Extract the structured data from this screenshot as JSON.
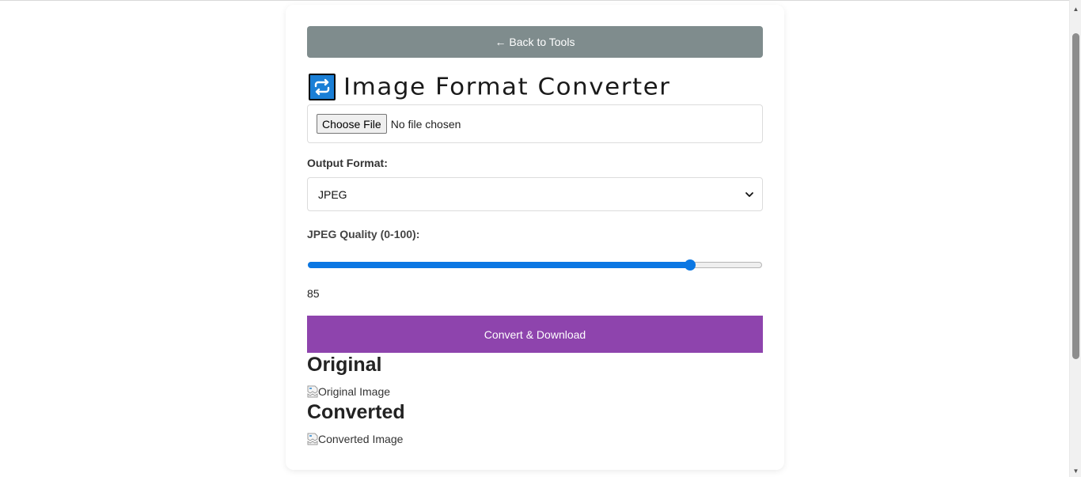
{
  "tool": {
    "back_label": "← Back to Tools",
    "title": "Image Format Converter",
    "title_icon": "repeat-arrows-icon",
    "file_input": {
      "button_label": "Choose File",
      "status": "No file chosen"
    },
    "output_format": {
      "label": "Output Format:",
      "selected": "JPEG"
    },
    "quality": {
      "label": "JPEG Quality (0-100):",
      "value": "85",
      "min": 0,
      "max": 100,
      "level": 85
    },
    "convert_label": "Convert & Download",
    "original": {
      "heading": "Original",
      "alt": "Original Image"
    },
    "converted": {
      "heading": "Converted",
      "alt": "Converted Image"
    }
  },
  "colors": {
    "back_button": "#7f8c8d",
    "convert_button": "#8e44ad",
    "slider_accent": "#0b77e3",
    "icon_bg": "#1a7fd6"
  }
}
